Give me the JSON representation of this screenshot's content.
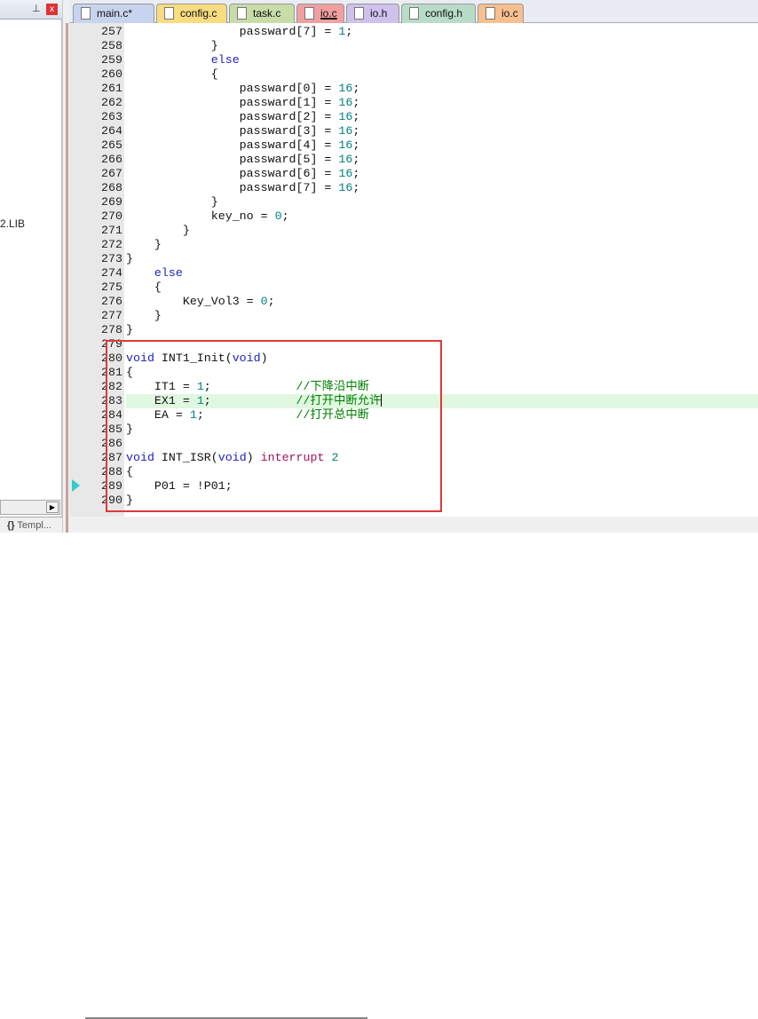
{
  "left_panel": {
    "pin_icon": "pin-icon",
    "close_icon": "close-icon",
    "item": "2.LIB",
    "bottom_tab": "Templ..."
  },
  "tabs": [
    {
      "label": "main.c*",
      "color": "#c8d4ee"
    },
    {
      "label": "config.c",
      "color": "#f8dc80"
    },
    {
      "label": "task.c",
      "color": "#c8dca8"
    },
    {
      "label": "io.c",
      "color": "#f0a0a0",
      "active": true
    },
    {
      "label": "io.h",
      "color": "#d0c0ec"
    },
    {
      "label": "config.h",
      "color": "#b8dcc8"
    },
    {
      "label": "io.c",
      "color": "#f8c090"
    }
  ],
  "highlight_color": "#e03838",
  "lines": [
    {
      "n": "257",
      "t": [
        [
          "",
          "                passward[7] = "
        ],
        [
          "num",
          "1"
        ],
        [
          "",
          ";"
        ]
      ]
    },
    {
      "n": "258",
      "t": [
        [
          "",
          "            }"
        ]
      ]
    },
    {
      "n": "259",
      "t": [
        [
          "",
          "            "
        ],
        [
          "kw",
          "else"
        ]
      ]
    },
    {
      "n": "260",
      "t": [
        [
          "",
          "            {"
        ]
      ]
    },
    {
      "n": "261",
      "t": [
        [
          "",
          "                passward[0] = "
        ],
        [
          "num",
          "16"
        ],
        [
          "",
          ";"
        ]
      ]
    },
    {
      "n": "262",
      "t": [
        [
          "",
          "                passward[1] = "
        ],
        [
          "num",
          "16"
        ],
        [
          "",
          ";"
        ]
      ]
    },
    {
      "n": "263",
      "t": [
        [
          "",
          "                passward[2] = "
        ],
        [
          "num",
          "16"
        ],
        [
          "",
          ";"
        ]
      ]
    },
    {
      "n": "264",
      "t": [
        [
          "",
          "                passward[3] = "
        ],
        [
          "num",
          "16"
        ],
        [
          "",
          ";"
        ]
      ]
    },
    {
      "n": "265",
      "t": [
        [
          "",
          "                passward[4] = "
        ],
        [
          "num",
          "16"
        ],
        [
          "",
          ";"
        ]
      ]
    },
    {
      "n": "266",
      "t": [
        [
          "",
          "                passward[5] = "
        ],
        [
          "num",
          "16"
        ],
        [
          "",
          ";"
        ]
      ]
    },
    {
      "n": "267",
      "t": [
        [
          "",
          "                passward[6] = "
        ],
        [
          "num",
          "16"
        ],
        [
          "",
          ";"
        ]
      ]
    },
    {
      "n": "268",
      "t": [
        [
          "",
          "                passward[7] = "
        ],
        [
          "num",
          "16"
        ],
        [
          "",
          ";"
        ]
      ]
    },
    {
      "n": "269",
      "t": [
        [
          "",
          "            }"
        ]
      ]
    },
    {
      "n": "270",
      "t": [
        [
          "",
          "            key_no = "
        ],
        [
          "num",
          "0"
        ],
        [
          "",
          ";"
        ]
      ]
    },
    {
      "n": "271",
      "t": [
        [
          "",
          "        }"
        ]
      ]
    },
    {
      "n": "272",
      "t": [
        [
          "",
          "    }"
        ]
      ]
    },
    {
      "n": "273",
      "t": [
        [
          "",
          "}"
        ]
      ]
    },
    {
      "n": "274",
      "t": [
        [
          "",
          "    "
        ],
        [
          "kw",
          "else"
        ]
      ]
    },
    {
      "n": "275",
      "t": [
        [
          "",
          "    {"
        ]
      ]
    },
    {
      "n": "276",
      "t": [
        [
          "",
          "        Key_Vol3 = "
        ],
        [
          "num",
          "0"
        ],
        [
          "",
          ";"
        ]
      ]
    },
    {
      "n": "277",
      "t": [
        [
          "",
          "    }"
        ]
      ]
    },
    {
      "n": "278",
      "t": [
        [
          "",
          "}"
        ]
      ]
    },
    {
      "n": "279",
      "t": []
    },
    {
      "n": "280",
      "t": [
        [
          "kw",
          "void"
        ],
        [
          "",
          " INT1_Init("
        ],
        [
          "kw",
          "void"
        ],
        [
          "",
          ")"
        ]
      ]
    },
    {
      "n": "281",
      "t": [
        [
          "",
          "{"
        ]
      ]
    },
    {
      "n": "282",
      "t": [
        [
          "",
          "    IT1 = "
        ],
        [
          "num",
          "1"
        ],
        [
          "",
          ";            "
        ],
        [
          "cm",
          "//下降沿中断"
        ]
      ]
    },
    {
      "n": "283",
      "t": [
        [
          "",
          "    EX1 = "
        ],
        [
          "num",
          "1"
        ],
        [
          "",
          ";            "
        ],
        [
          "cm",
          "//打开中断允许"
        ]
      ],
      "current": true
    },
    {
      "n": "284",
      "t": [
        [
          "",
          "    EA = "
        ],
        [
          "num",
          "1"
        ],
        [
          "",
          ";             "
        ],
        [
          "cm",
          "//打开总中断"
        ]
      ]
    },
    {
      "n": "285",
      "t": [
        [
          "",
          "}"
        ]
      ]
    },
    {
      "n": "286",
      "t": []
    },
    {
      "n": "287",
      "t": [
        [
          "kw",
          "void"
        ],
        [
          "",
          " INT_ISR("
        ],
        [
          "kw",
          "void"
        ],
        [
          "",
          ") "
        ],
        [
          "kw2",
          "interrupt"
        ],
        [
          "",
          " "
        ],
        [
          "num",
          "2"
        ]
      ]
    },
    {
      "n": "288",
      "t": [
        [
          "",
          "{"
        ]
      ]
    },
    {
      "n": "289",
      "t": [
        [
          "",
          "    P01 = !P01;"
        ]
      ]
    },
    {
      "n": "290",
      "t": [
        [
          "",
          "}"
        ]
      ]
    }
  ]
}
